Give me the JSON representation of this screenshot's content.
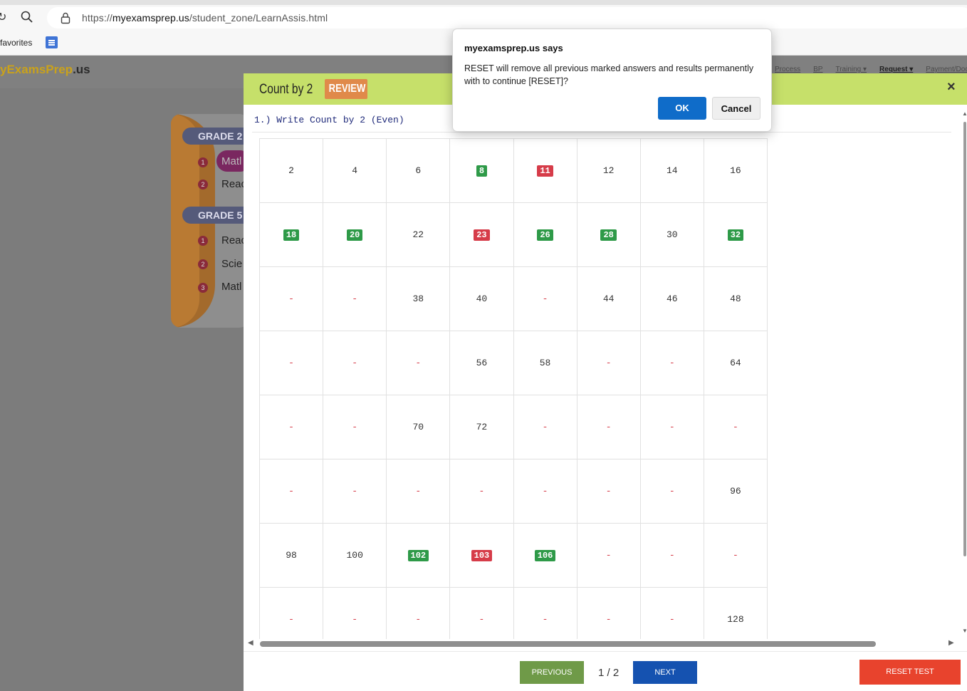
{
  "browser": {
    "back_glyph": "↻",
    "url_prefix": "https://",
    "url_host": "myexamsprep.us",
    "url_path": "/student_zone/LearnAssis.html",
    "favorites_label": "favorites"
  },
  "site": {
    "logo_main": "yExamsPrep",
    "logo_tld": ".us",
    "nav": [
      "Process",
      "BP",
      "Training ▾",
      "Request ▾",
      "Payment/Docs"
    ]
  },
  "left_panel": {
    "grade2": "GRADE 2",
    "grade2_items": [
      {
        "num": "1",
        "label": "Matl"
      },
      {
        "num": "2",
        "label": "Reac"
      }
    ],
    "grade5": "GRADE 5",
    "grade5_items": [
      {
        "num": "1",
        "label": "Reac"
      },
      {
        "num": "2",
        "label": "Scie"
      },
      {
        "num": "3",
        "label": "Matl"
      }
    ]
  },
  "modal": {
    "title": "Count by 2",
    "badge": "REVIEW",
    "close": "×",
    "question": "1.) Write Count by 2 (Even)",
    "grid": [
      [
        {
          "v": "2",
          "s": "n"
        },
        {
          "v": "4",
          "s": "n"
        },
        {
          "v": "6",
          "s": "n"
        },
        {
          "v": "8",
          "s": "g"
        },
        {
          "v": "11",
          "s": "r"
        },
        {
          "v": "12",
          "s": "n"
        },
        {
          "v": "14",
          "s": "n"
        },
        {
          "v": "16",
          "s": "n"
        }
      ],
      [
        {
          "v": "18",
          "s": "g"
        },
        {
          "v": "20",
          "s": "g"
        },
        {
          "v": "22",
          "s": "n"
        },
        {
          "v": "23",
          "s": "r"
        },
        {
          "v": "26",
          "s": "g"
        },
        {
          "v": "28",
          "s": "g"
        },
        {
          "v": "30",
          "s": "n"
        },
        {
          "v": "32",
          "s": "g"
        }
      ],
      [
        {
          "v": "-",
          "s": "d"
        },
        {
          "v": "-",
          "s": "d"
        },
        {
          "v": "38",
          "s": "n"
        },
        {
          "v": "40",
          "s": "n"
        },
        {
          "v": "-",
          "s": "d"
        },
        {
          "v": "44",
          "s": "n"
        },
        {
          "v": "46",
          "s": "n"
        },
        {
          "v": "48",
          "s": "n"
        }
      ],
      [
        {
          "v": "-",
          "s": "d"
        },
        {
          "v": "-",
          "s": "d"
        },
        {
          "v": "-",
          "s": "d"
        },
        {
          "v": "56",
          "s": "n"
        },
        {
          "v": "58",
          "s": "n"
        },
        {
          "v": "-",
          "s": "d"
        },
        {
          "v": "-",
          "s": "d"
        },
        {
          "v": "64",
          "s": "n"
        }
      ],
      [
        {
          "v": "-",
          "s": "d"
        },
        {
          "v": "-",
          "s": "d"
        },
        {
          "v": "70",
          "s": "n"
        },
        {
          "v": "72",
          "s": "n"
        },
        {
          "v": "-",
          "s": "d"
        },
        {
          "v": "-",
          "s": "d"
        },
        {
          "v": "-",
          "s": "d"
        },
        {
          "v": "-",
          "s": "d"
        }
      ],
      [
        {
          "v": "-",
          "s": "d"
        },
        {
          "v": "-",
          "s": "d"
        },
        {
          "v": "-",
          "s": "d"
        },
        {
          "v": "-",
          "s": "d"
        },
        {
          "v": "-",
          "s": "d"
        },
        {
          "v": "-",
          "s": "d"
        },
        {
          "v": "-",
          "s": "d"
        },
        {
          "v": "96",
          "s": "n"
        }
      ],
      [
        {
          "v": "98",
          "s": "n"
        },
        {
          "v": "100",
          "s": "n"
        },
        {
          "v": "102",
          "s": "g"
        },
        {
          "v": "103",
          "s": "r"
        },
        {
          "v": "106",
          "s": "g"
        },
        {
          "v": "-",
          "s": "d"
        },
        {
          "v": "-",
          "s": "d"
        },
        {
          "v": "-",
          "s": "d"
        }
      ],
      [
        {
          "v": "-",
          "s": "d"
        },
        {
          "v": "-",
          "s": "d"
        },
        {
          "v": "-",
          "s": "d"
        },
        {
          "v": "-",
          "s": "d"
        },
        {
          "v": "-",
          "s": "d"
        },
        {
          "v": "-",
          "s": "d"
        },
        {
          "v": "-",
          "s": "d"
        },
        {
          "v": "128",
          "s": "n"
        }
      ]
    ],
    "prev_label": "PREVIOUS",
    "page_indicator": "1 / 2",
    "next_label": "NEXT",
    "reset_label": "RESET TEST"
  },
  "dialog": {
    "title": "myexamsprep.us says",
    "message": "RESET will remove all previous marked answers and results permanently with to continue [RESET]?",
    "ok_label": "OK",
    "cancel_label": "Cancel"
  },
  "colors": {
    "header_bg": "#c6e06a",
    "review_badge": "#e08a4a",
    "correct": "#2e9a48",
    "wrong": "#d63c49",
    "next_button": "#1552b0",
    "prev_button": "#6f9a48",
    "reset_button": "#e8432d",
    "dialog_ok": "#0f6cc9"
  }
}
